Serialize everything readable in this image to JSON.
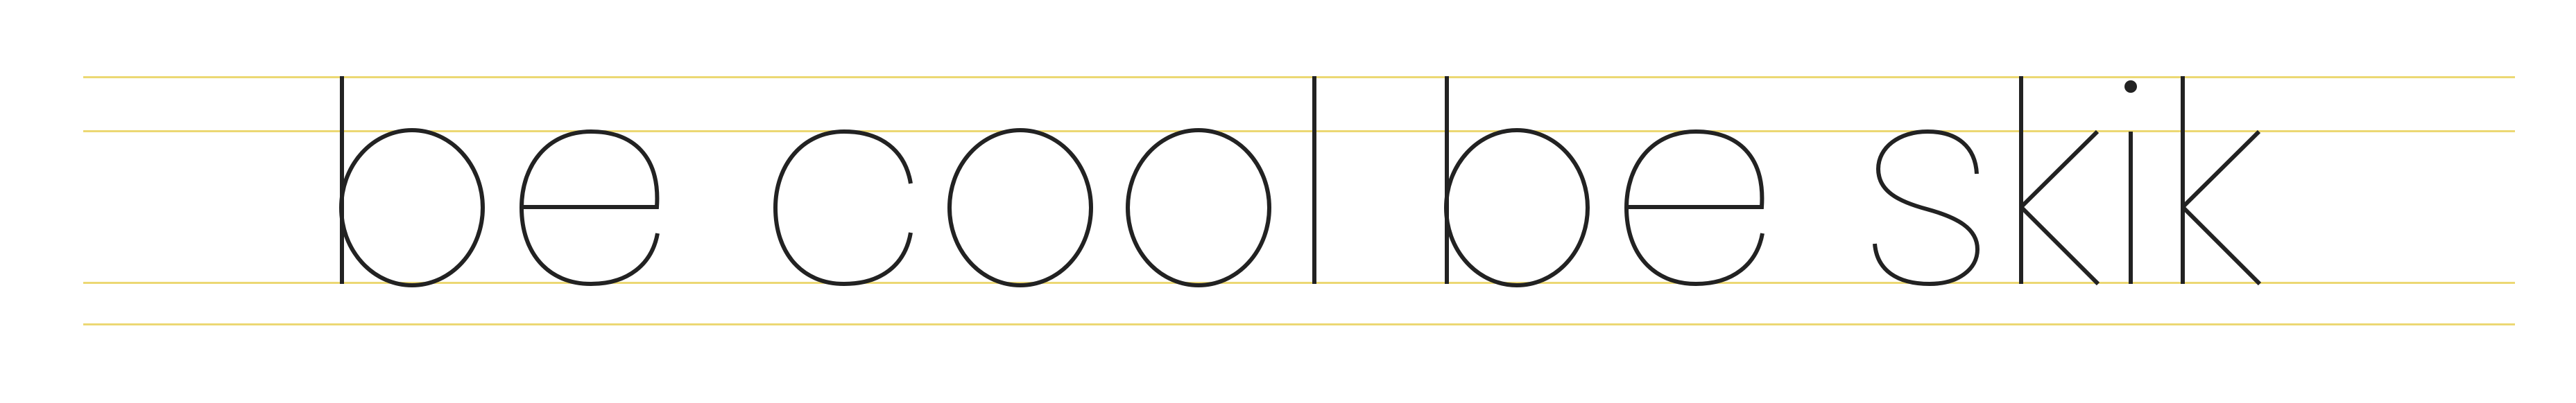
{
  "specimen": {
    "text": "be cool be skik",
    "stroke_color": "#222222",
    "guide_color": "#ecd873"
  }
}
